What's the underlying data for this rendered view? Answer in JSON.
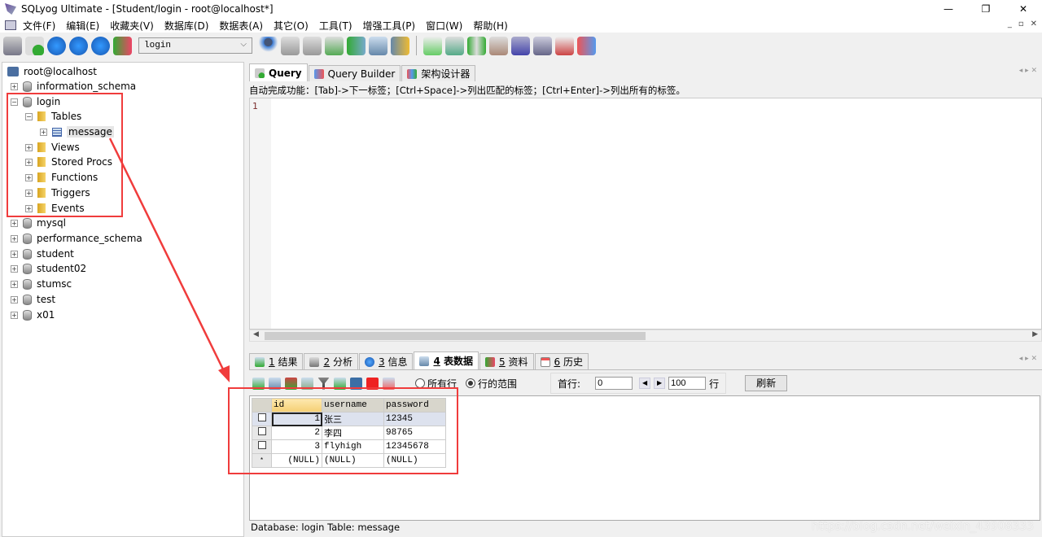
{
  "window": {
    "title": "SQLyog Ultimate - [Student/login - root@localhost*]",
    "min": "—",
    "max": "❐",
    "close": "✕"
  },
  "menu": [
    "文件(F)",
    "编辑(E)",
    "收藏夹(V)",
    "数据库(D)",
    "数据表(A)",
    "其它(O)",
    "工具(T)",
    "增强工具(P)",
    "窗口(W)",
    "帮助(H)"
  ],
  "toolbar": {
    "database_selected": "login"
  },
  "tree": {
    "root": "root@localhost",
    "nodes": [
      {
        "label": "information_schema"
      },
      {
        "label": "login"
      },
      {
        "label": "Tables"
      },
      {
        "label": "message"
      },
      {
        "label": "Views"
      },
      {
        "label": "Stored Procs"
      },
      {
        "label": "Functions"
      },
      {
        "label": "Triggers"
      },
      {
        "label": "Events"
      },
      {
        "label": "mysql"
      },
      {
        "label": "performance_schema"
      },
      {
        "label": "student"
      },
      {
        "label": "student02"
      },
      {
        "label": "stumsc"
      },
      {
        "label": "test"
      },
      {
        "label": "x01"
      }
    ]
  },
  "editor_tabs": [
    "Query",
    "Query Builder",
    "架构设计器"
  ],
  "hint": "自动完成功能：[Tab]->下一标签；[Ctrl+Space]->列出匹配的标签；[Ctrl+Enter]->列出所有的标签。",
  "editor": {
    "line": "1"
  },
  "result_tabs": [
    {
      "num": "1",
      "label": "结果"
    },
    {
      "num": "2",
      "label": "分析"
    },
    {
      "num": "3",
      "label": "信息"
    },
    {
      "num": "4",
      "label": "表数据"
    },
    {
      "num": "5",
      "label": "资料"
    },
    {
      "num": "6",
      "label": "历史"
    }
  ],
  "result_toolbar": {
    "radio_all": "所有行",
    "radio_range": "行的范围",
    "first_row_label": "首行:",
    "first_row": "0",
    "count": "100",
    "rows_suffix": "行",
    "refresh": "刷新"
  },
  "grid": {
    "columns": [
      "id",
      "username",
      "password"
    ],
    "rows": [
      [
        "1",
        "张三",
        "12345"
      ],
      [
        "2",
        "李四",
        "98765"
      ],
      [
        "3",
        "flyhigh",
        "12345678"
      ],
      [
        "(NULL)",
        "(NULL)",
        "(NULL)"
      ]
    ],
    "new_row_marker": "*"
  },
  "status": "Database: login Table: message",
  "watermark": "https://blog.csdn.net/weixin_43908333"
}
